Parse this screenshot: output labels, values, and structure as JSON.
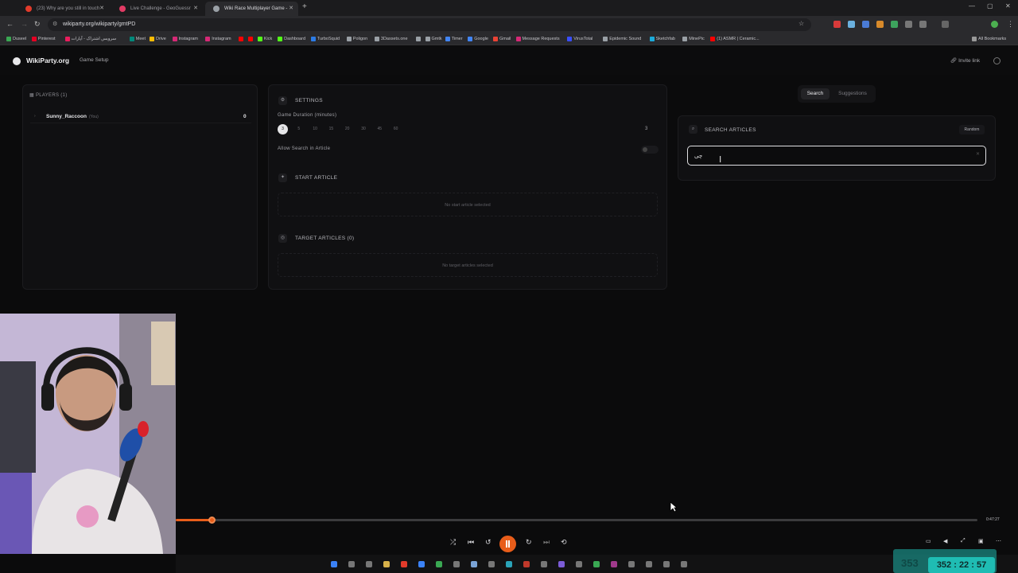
{
  "browser": {
    "tabs": [
      {
        "title": "(23) Why are you still in touch",
        "color": "#e23b2b"
      },
      {
        "title": "Live Challenge - GeoGuessr",
        "color": "#e23b64"
      },
      {
        "title": "Wiki Race Multiplayer Game -",
        "color": "#9aa0a6"
      }
    ],
    "url": "wikiparty.org/wikiparty/gmtPD",
    "bookmarks": [
      {
        "label": "Duseel",
        "color": "#3aa853"
      },
      {
        "label": "Pinterest",
        "color": "#e60023"
      },
      {
        "label": "سرویس اشتراک - آپارات",
        "color": "#ea1d5d"
      },
      {
        "label": "Meet",
        "color": "#00897b"
      },
      {
        "label": "Drive",
        "color": "#fbbc04"
      },
      {
        "label": "Instagram",
        "color": "#d62976"
      },
      {
        "label": "Instagram",
        "color": "#d62976"
      },
      {
        "label": "",
        "color": "#ff0000"
      },
      {
        "label": "",
        "color": "#ff0000"
      },
      {
        "label": "Kick",
        "color": "#53fc18"
      },
      {
        "label": "Dashboard",
        "color": "#53fc18"
      },
      {
        "label": "TurboSquid",
        "color": "#2c7be5"
      },
      {
        "label": "Poligon",
        "color": "#9aa0a6"
      },
      {
        "label": "3Dassets.one",
        "color": "#9aa0a6"
      },
      {
        "label": "",
        "color": "#9aa0a6"
      },
      {
        "label": "Gmtk",
        "color": "#9aa0a6"
      },
      {
        "label": "Timer",
        "color": "#4285f4"
      },
      {
        "label": "Google",
        "color": "#4285f4"
      },
      {
        "label": "Gmail",
        "color": "#ea4335"
      },
      {
        "label": "Message Requests",
        "color": "#d62976"
      },
      {
        "label": "VirusTotal",
        "color": "#394eff"
      },
      {
        "label": "Epidemic Sound",
        "color": "#9aa0a6"
      },
      {
        "label": "Sketchfab",
        "color": "#1caad9"
      },
      {
        "label": "MinePic",
        "color": "#9aa0a6"
      },
      {
        "label": "(1) ASMR | Ceramic...",
        "color": "#ff0000"
      }
    ],
    "all_bookmarks": "All Bookmarks"
  },
  "app": {
    "logo": "WikiParty.org",
    "nav_link": "Game Setup",
    "invite_link": "Invite link"
  },
  "players": {
    "header": "PLAYERS (1)",
    "list": [
      {
        "name": "Sunny_Raccoon",
        "tag": "(You)",
        "score": "0"
      }
    ]
  },
  "settings": {
    "title": "SETTINGS",
    "duration_label": "Game Duration (minutes)",
    "durations": [
      "3",
      "5",
      "10",
      "15",
      "20",
      "30",
      "45",
      "60"
    ],
    "selected_duration": "3",
    "duration_value": "3",
    "allow_search_label": "Allow Search in Article",
    "allow_search_on": false
  },
  "start_article": {
    "title": "START ARTICLE",
    "empty": "No start article selected"
  },
  "target_articles": {
    "title": "TARGET ARTICLES (0)",
    "empty": "No target articles selected"
  },
  "search": {
    "tabs": [
      "Search",
      "Suggestions"
    ],
    "active_tab": "Search",
    "title": "SEARCH ARTICLES",
    "random_label": "Random",
    "input_value": "چی"
  },
  "player": {
    "progress": 0.045,
    "time": "0:47:27"
  },
  "overlay": {
    "timer": "352 : 22 : 57",
    "ghost": "353"
  }
}
